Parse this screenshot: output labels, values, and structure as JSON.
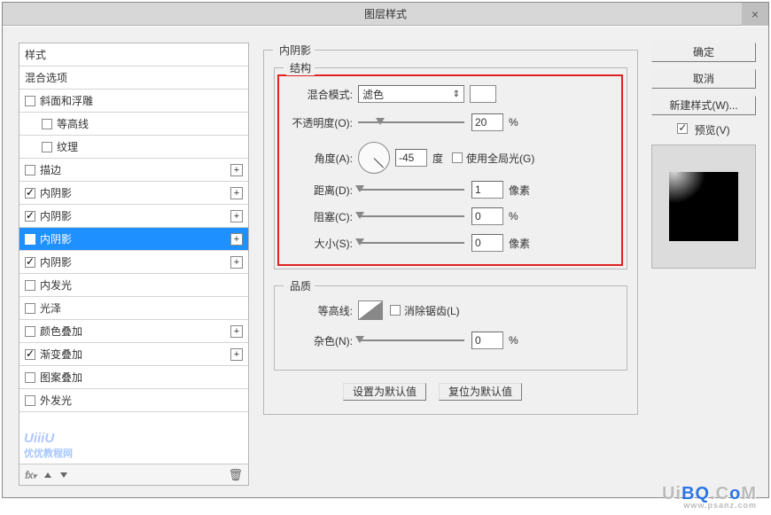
{
  "title": "图层样式",
  "left": {
    "header1": "样式",
    "header2": "混合选项",
    "items": [
      {
        "label": "斜面和浮雕",
        "checked": false,
        "plus": false,
        "indent": 0
      },
      {
        "label": "等高线",
        "checked": false,
        "plus": false,
        "indent": 1
      },
      {
        "label": "纹理",
        "checked": false,
        "plus": false,
        "indent": 1
      },
      {
        "label": "描边",
        "checked": false,
        "plus": true,
        "indent": 0
      },
      {
        "label": "内阴影",
        "checked": true,
        "plus": true,
        "indent": 0
      },
      {
        "label": "内阴影",
        "checked": true,
        "plus": true,
        "indent": 0
      },
      {
        "label": "内阴影",
        "checked": true,
        "plus": true,
        "indent": 0,
        "selected": true
      },
      {
        "label": "内阴影",
        "checked": true,
        "plus": true,
        "indent": 0
      },
      {
        "label": "内发光",
        "checked": false,
        "plus": false,
        "indent": 0
      },
      {
        "label": "光泽",
        "checked": false,
        "plus": false,
        "indent": 0
      },
      {
        "label": "颜色叠加",
        "checked": false,
        "plus": true,
        "indent": 0
      },
      {
        "label": "渐变叠加",
        "checked": true,
        "plus": true,
        "indent": 0
      },
      {
        "label": "图案叠加",
        "checked": false,
        "plus": false,
        "indent": 0
      },
      {
        "label": "外发光",
        "checked": false,
        "plus": false,
        "indent": 0
      }
    ]
  },
  "center": {
    "section_title": "内阴影",
    "group_struct": "结构",
    "blend_label": "混合模式:",
    "blend_value": "滤色",
    "opacity_label": "不透明度(O):",
    "opacity_val": "20",
    "percent": "%",
    "angle_label": "角度(A):",
    "angle_val": "-45",
    "deg": "度",
    "global_light": "使用全局光(G)",
    "distance_label": "距离(D):",
    "distance_val": "1",
    "px": "像素",
    "choke_label": "阻塞(C):",
    "choke_val": "0",
    "size_label": "大小(S):",
    "size_val": "0",
    "group_quality": "品质",
    "contour_label": "等高线:",
    "antialias": "消除锯齿(L)",
    "noise_label": "杂色(N):",
    "noise_val": "0",
    "btn_default": "设置为默认值",
    "btn_reset": "复位为默认值"
  },
  "right": {
    "ok": "确定",
    "cancel": "取消",
    "new_style": "新建样式(W)...",
    "preview": "预览(V)"
  },
  "watermark": {
    "left_line1": "UiiiU",
    "left_line2": "优优教程网",
    "right": "UiBQ.CoM",
    "right_sub": "www.psanz.com"
  }
}
